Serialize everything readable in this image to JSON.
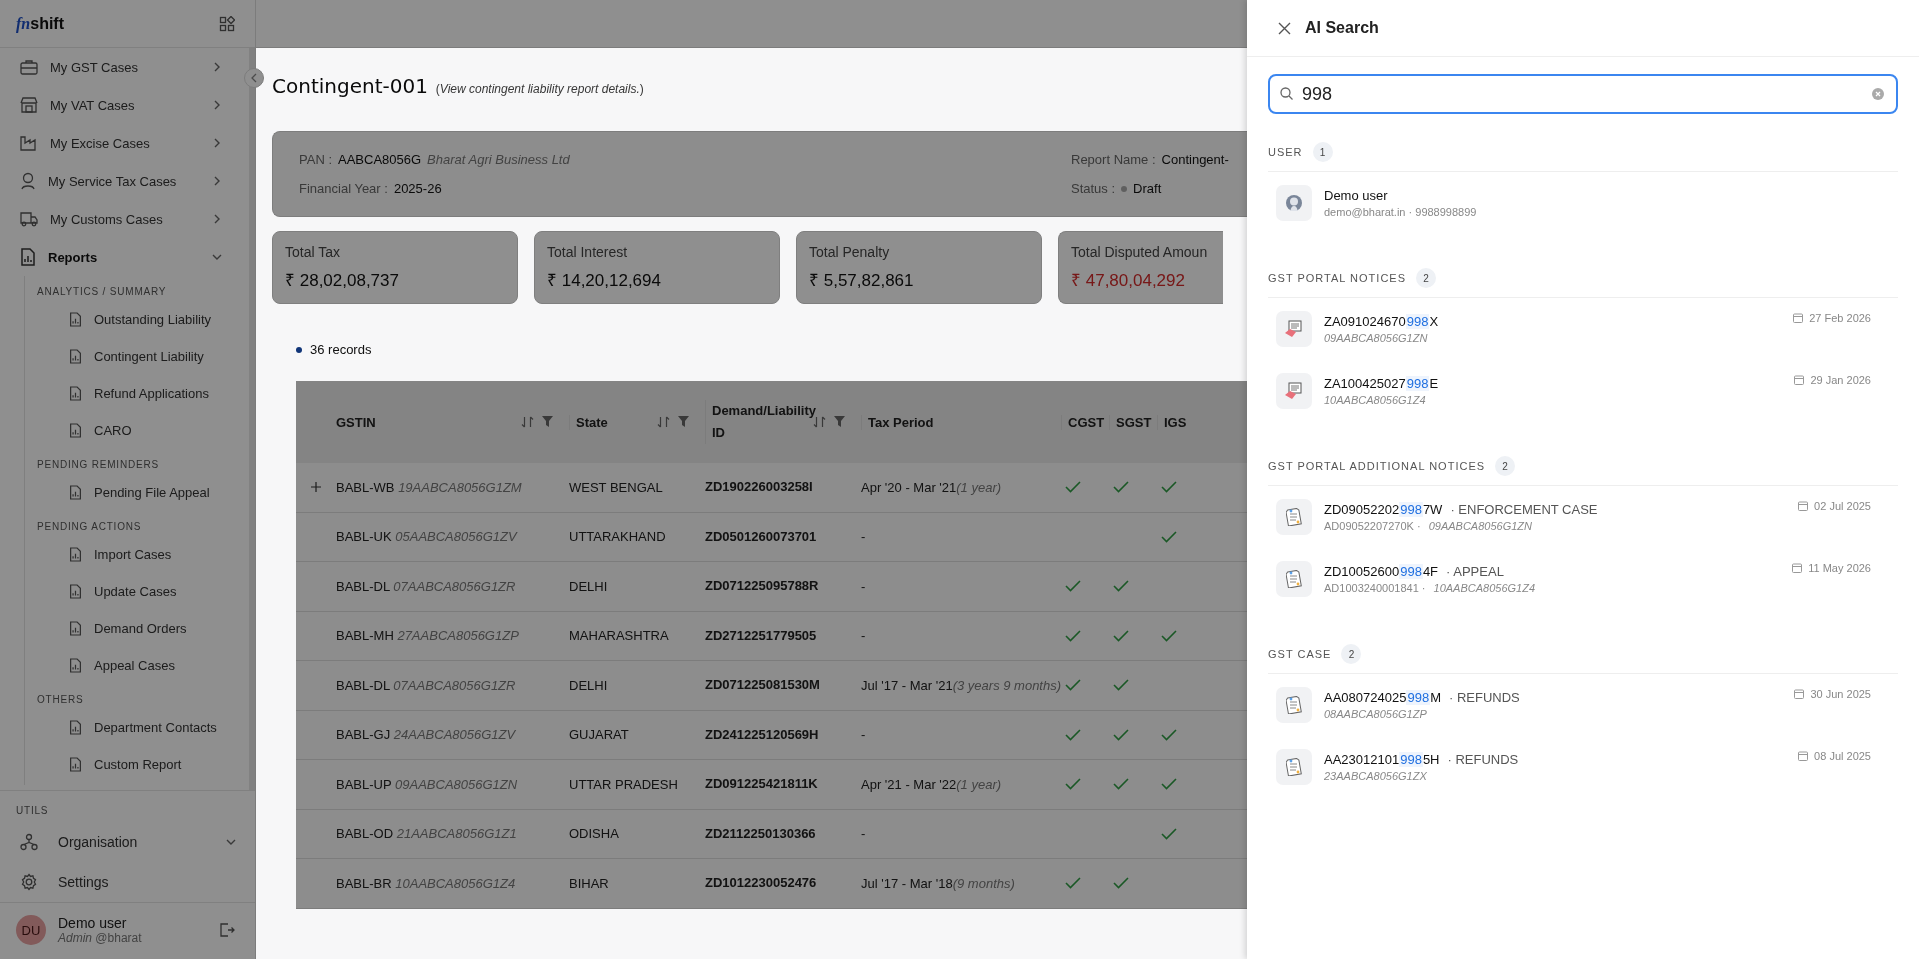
{
  "sidebar": {
    "logo": {
      "mark": "fn",
      "text": "shift"
    },
    "nav": [
      {
        "label": "My GST Cases",
        "expanded": false
      },
      {
        "label": "My VAT Cases",
        "expanded": false
      },
      {
        "label": "My Excise Cases",
        "expanded": false
      },
      {
        "label": "My Service Tax Cases",
        "expanded": false
      },
      {
        "label": "My Customs Cases",
        "expanded": false
      },
      {
        "label": "Reports",
        "expanded": true,
        "groups": [
          {
            "heading": "ANALYTICS / SUMMARY",
            "items": [
              "Outstanding Liability",
              "Contingent Liability",
              "Refund Applications",
              "CARO"
            ]
          },
          {
            "heading": "PENDING REMINDERS",
            "items": [
              "Pending File Appeal"
            ]
          },
          {
            "heading": "PENDING ACTIONS",
            "items": [
              "Import Cases",
              "Update Cases",
              "Demand Orders",
              "Appeal Cases"
            ]
          },
          {
            "heading": "OTHERS",
            "items": [
              "Department Contacts",
              "Custom Report"
            ]
          }
        ]
      }
    ],
    "utils_heading": "UTILS",
    "utils": [
      {
        "label": "Organisation",
        "expanded": false
      },
      {
        "label": "Settings"
      }
    ],
    "user": {
      "initials": "DU",
      "name": "Demo user",
      "role": "Admin",
      "handle": "@bharat"
    }
  },
  "page": {
    "title": "Contingent-001",
    "subtitle": "(*View contingent liability report details.*)",
    "info": {
      "pan_label": "PAN :",
      "pan": "AABCA8056G",
      "company": "Bharat Agri Business Ltd",
      "fy_label": "Financial Year :",
      "fy": "2025-26",
      "report_label": "Report Name :",
      "report": "Contingent-",
      "status_label": "Status :",
      "status": "Draft"
    },
    "stats": [
      {
        "label": "Total Tax",
        "value": "₹ 28,02,08,737",
        "alert": false
      },
      {
        "label": "Total Interest",
        "value": "₹ 14,20,12,694",
        "alert": false
      },
      {
        "label": "Total Penalty",
        "value": "₹ 5,57,82,861",
        "alert": false
      },
      {
        "label": "Total Disputed Amoun",
        "value": "₹ 47,80,04,292",
        "alert": true
      }
    ],
    "records": "36 records",
    "table": {
      "columns": [
        "GSTIN",
        "State",
        "Demand/Liability ID",
        "Tax Period",
        "CGST",
        "SGST",
        "IGS"
      ],
      "rows": [
        {
          "expandable": true,
          "code": "BABL-WB",
          "gstin": "19AABCA8056G1ZM",
          "state": "WEST BENGAL",
          "id": "ZD190226003258I",
          "period": "Apr '20 - Mar '21",
          "duration": "(1 year)",
          "cgst": true,
          "sgst": true,
          "igst": true
        },
        {
          "expandable": false,
          "code": "BABL-UK",
          "gstin": "05AABCA8056G1ZV",
          "state": "UTTARAKHAND",
          "id": "ZD0501260073701",
          "period": "-",
          "cgst": false,
          "sgst": false,
          "igst": true
        },
        {
          "expandable": false,
          "code": "BABL-DL",
          "gstin": "07AABCA8056G1ZR",
          "state": "DELHI",
          "id": "ZD071225095788R",
          "period": "-",
          "cgst": true,
          "sgst": true,
          "igst": false
        },
        {
          "expandable": false,
          "code": "BABL-MH",
          "gstin": "27AABCA8056G1ZP",
          "state": "MAHARASHTRA",
          "id": "ZD2712251779505",
          "period": "-",
          "cgst": true,
          "sgst": true,
          "igst": true
        },
        {
          "expandable": false,
          "code": "BABL-DL",
          "gstin": "07AABCA8056G1ZR",
          "state": "DELHI",
          "id": "ZD071225081530M",
          "period": "Jul '17 - Mar '21",
          "duration": "(3 years 9 months)",
          "cgst": true,
          "sgst": true,
          "igst": false
        },
        {
          "expandable": false,
          "code": "BABL-GJ",
          "gstin": "24AABCA8056G1ZV",
          "state": "GUJARAT",
          "id": "ZD241225120569H",
          "period": "-",
          "cgst": true,
          "sgst": true,
          "igst": true
        },
        {
          "expandable": false,
          "code": "BABL-UP",
          "gstin": "09AABCA8056G1ZN",
          "state": "UTTAR PRADESH",
          "id": "ZD091225421811K",
          "period": "Apr '21 - Mar '22",
          "duration": "(1 year)",
          "cgst": true,
          "sgst": true,
          "igst": true
        },
        {
          "expandable": false,
          "code": "BABL-OD",
          "gstin": "21AABCA8056G1Z1",
          "state": "ODISHA",
          "id": "ZD2112250130366",
          "period": "-",
          "cgst": false,
          "sgst": false,
          "igst": true
        },
        {
          "expandable": false,
          "code": "BABL-BR",
          "gstin": "10AABCA8056G1Z4",
          "state": "BIHAR",
          "id": "ZD1012230052476",
          "period": "Jul '17 - Mar '18",
          "duration": "(9 months)",
          "cgst": true,
          "sgst": true,
          "igst": false
        }
      ]
    }
  },
  "search_panel": {
    "title": "AI Search",
    "query": "998",
    "sections": [
      {
        "title": "USER",
        "count": "1",
        "items": [
          {
            "kind": "user",
            "name": "Demo user",
            "detail": "demo@bharat.in · 9988998899"
          }
        ]
      },
      {
        "title": "GST PORTAL NOTICES",
        "count": "2",
        "items": [
          {
            "kind": "notice",
            "before": "ZA091024670",
            "match": "998",
            "after": "X",
            "gstin": "09AABCA8056G1ZN",
            "date": "27 Feb 2026"
          },
          {
            "kind": "notice",
            "before": "ZA100425027",
            "match": "998",
            "after": "E",
            "gstin": "10AABCA8056G1Z4",
            "date": "29 Jan 2026"
          }
        ]
      },
      {
        "title": "GST PORTAL ADDITIONAL NOTICES",
        "count": "2",
        "items": [
          {
            "kind": "document",
            "before": "ZD09052202",
            "match": "998",
            "after": "7W",
            "tag": "· ENFORCEMENT CASE",
            "ref": "AD09052207270K ·",
            "gstin": "09AABCA8056G1ZN",
            "date": "02 Jul 2025"
          },
          {
            "kind": "document",
            "before": "ZD10052600",
            "match": "998",
            "after": "4F",
            "tag": "· APPEAL",
            "ref": "AD1003240001841 ·",
            "gstin": "10AABCA8056G1Z4",
            "date": "11 May 2026"
          }
        ]
      },
      {
        "title": "GST CASE",
        "count": "2",
        "items": [
          {
            "kind": "document",
            "before": "AA080724025",
            "match": "998",
            "after": "M",
            "tag": "· REFUNDS",
            "gstin": "08AABCA8056G1ZP",
            "date": "30 Jun 2025"
          },
          {
            "kind": "document",
            "before": "AA23012101",
            "match": "998",
            "after": "5H",
            "tag": "· REFUNDS",
            "gstin": "23AABCA8056G1ZX",
            "date": "08 Jul 2025"
          }
        ]
      }
    ]
  }
}
